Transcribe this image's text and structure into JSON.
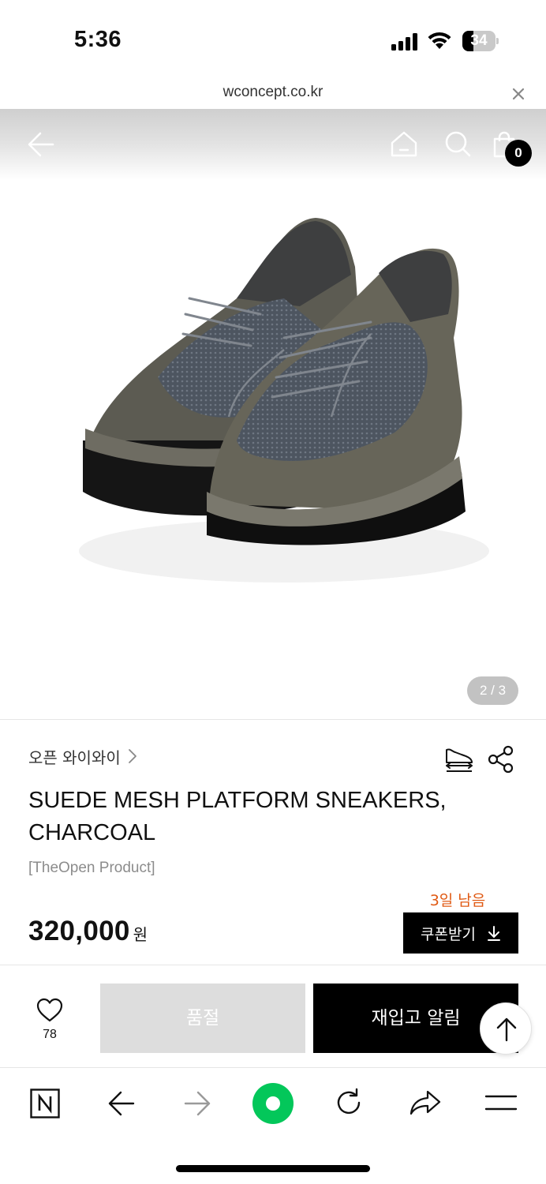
{
  "status_bar": {
    "time": "5:36",
    "battery": "34"
  },
  "browser": {
    "url": "wconcept.co.kr"
  },
  "header": {
    "cart_count": "0"
  },
  "gallery": {
    "indicator": "2 / 3"
  },
  "product": {
    "brand": "오픈 와이와이",
    "title": "SUEDE MESH PLATFORM SNEAKERS, CHARCOAL",
    "subtitle": "[TheOpen Product]",
    "coupon_days": "3일 남음",
    "price": "320,000",
    "currency": "원",
    "coupon_label": "쿠폰받기"
  },
  "purchase_bar": {
    "like_count": "78",
    "soldout_label": "품절",
    "restock_label": "재입고 알림"
  },
  "icons": {
    "back": "back-arrow-icon",
    "home": "home-icon",
    "search": "search-icon",
    "cart": "shopping-bag-icon",
    "size": "shoe-size-icon",
    "share": "share-icon",
    "like": "heart-icon",
    "scroll_top": "arrow-up-icon"
  },
  "colors": {
    "accent_orange": "#e05a14",
    "naver_green": "#03c75a",
    "soldout_gray": "#dddddd"
  }
}
